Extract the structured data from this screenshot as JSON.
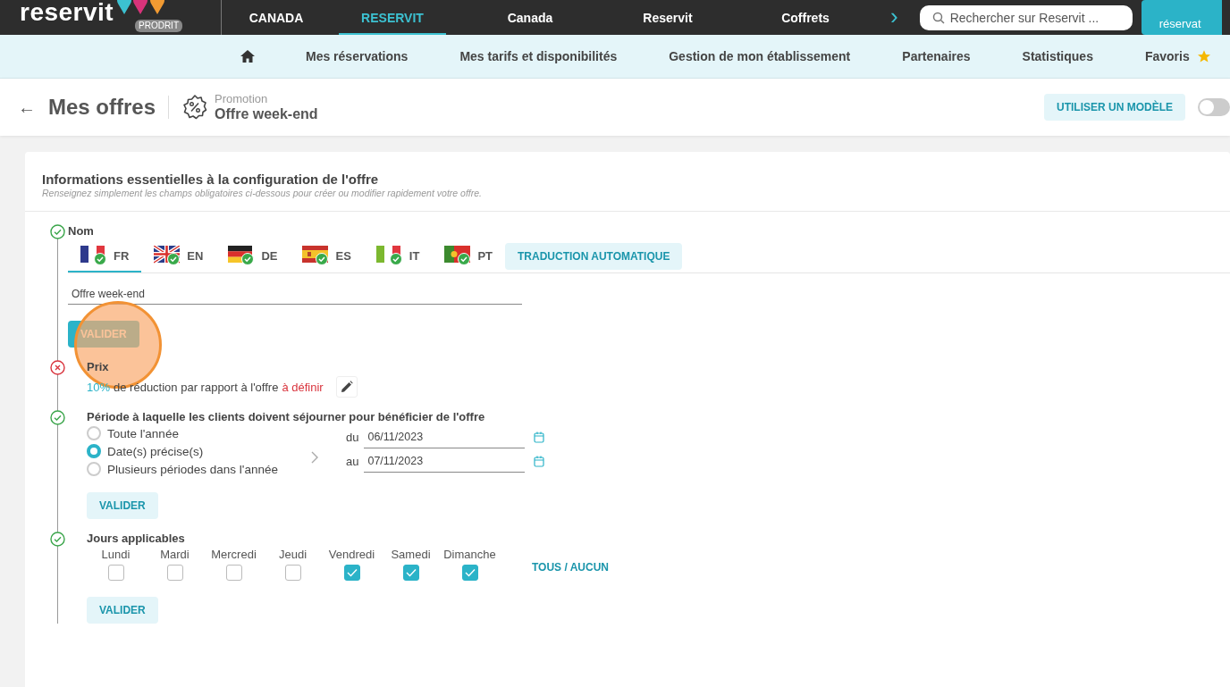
{
  "top_nav": {
    "logo": "reservit",
    "env_badge": "PRODRIT",
    "items": [
      {
        "label": "CANADA",
        "selected": false
      },
      {
        "label": "RESERVIT",
        "selected": true
      },
      {
        "label": "Canada",
        "selected": false
      },
      {
        "label": "Reservit",
        "selected": false
      },
      {
        "label": "Coffrets",
        "selected": false
      }
    ],
    "more": "›",
    "search": {
      "placeholder": "Rechercher sur Reservit ..."
    },
    "cta": "réservat"
  },
  "main_nav": {
    "items": [
      {
        "label": "Mes réservations"
      },
      {
        "label": "Mes tarifs et disponibilités"
      },
      {
        "label": "Gestion de mon établissement"
      },
      {
        "label": "Partenaires"
      },
      {
        "label": "Statistiques"
      },
      {
        "label": "Favoris"
      }
    ]
  },
  "header": {
    "back": "←",
    "title": "Mes offres",
    "type": "Promotion",
    "offer_name": "Offre week-end",
    "template_button": "UTILISER UN MODÈLE",
    "toggle_on": false
  },
  "section": {
    "title": "Informations essentielles à la configuration de l'offre",
    "subtitle": "Renseignez simplement les champs obligatoires ci-dessous pour créer ou modifier rapidement votre offre.",
    "steps": [
      {
        "kind": "name",
        "valid": true,
        "label": "Nom",
        "languages": [
          {
            "code": "FR",
            "selected": true,
            "done": true
          },
          {
            "code": "EN",
            "selected": false,
            "done": true
          },
          {
            "code": "DE",
            "selected": false,
            "done": true
          },
          {
            "code": "ES",
            "selected": false,
            "done": true
          },
          {
            "code": "IT",
            "selected": false,
            "done": true
          },
          {
            "code": "PT",
            "selected": false,
            "done": true
          }
        ],
        "translate_button": "TRADUCTION AUTOMATIQUE",
        "value": "Offre week-end",
        "button": "VALIDER",
        "click_highlight": true
      },
      {
        "kind": "price",
        "valid": false,
        "label": "Prix",
        "amount": "10%",
        "text": "de réduction par rapport à l'offre",
        "missing": "à définir"
      },
      {
        "kind": "period",
        "valid": true,
        "label": "Période à laquelle les clients doivent séjourner pour bénéficier de l'offre",
        "options": [
          {
            "label": "Toute l'année",
            "selected": false
          },
          {
            "label": "Date(s) précise(s)",
            "selected": true
          },
          {
            "label": "Plusieurs périodes dans l'année",
            "selected": false
          }
        ],
        "dates": [
          {
            "prefix": "du",
            "value": "06/11/2023"
          },
          {
            "prefix": "au",
            "value": "07/11/2023"
          }
        ],
        "button": "VALIDER"
      },
      {
        "kind": "days",
        "valid": true,
        "label": "Jours applicables",
        "days": [
          {
            "label": "Lundi",
            "checked": false
          },
          {
            "label": "Mardi",
            "checked": false
          },
          {
            "label": "Mercredi",
            "checked": false
          },
          {
            "label": "Jeudi",
            "checked": false
          },
          {
            "label": "Vendredi",
            "checked": true
          },
          {
            "label": "Samedi",
            "checked": true
          },
          {
            "label": "Dimanche",
            "checked": true
          }
        ],
        "toggle_all": "TOUS / AUCUN",
        "button": "VALIDER"
      }
    ]
  }
}
